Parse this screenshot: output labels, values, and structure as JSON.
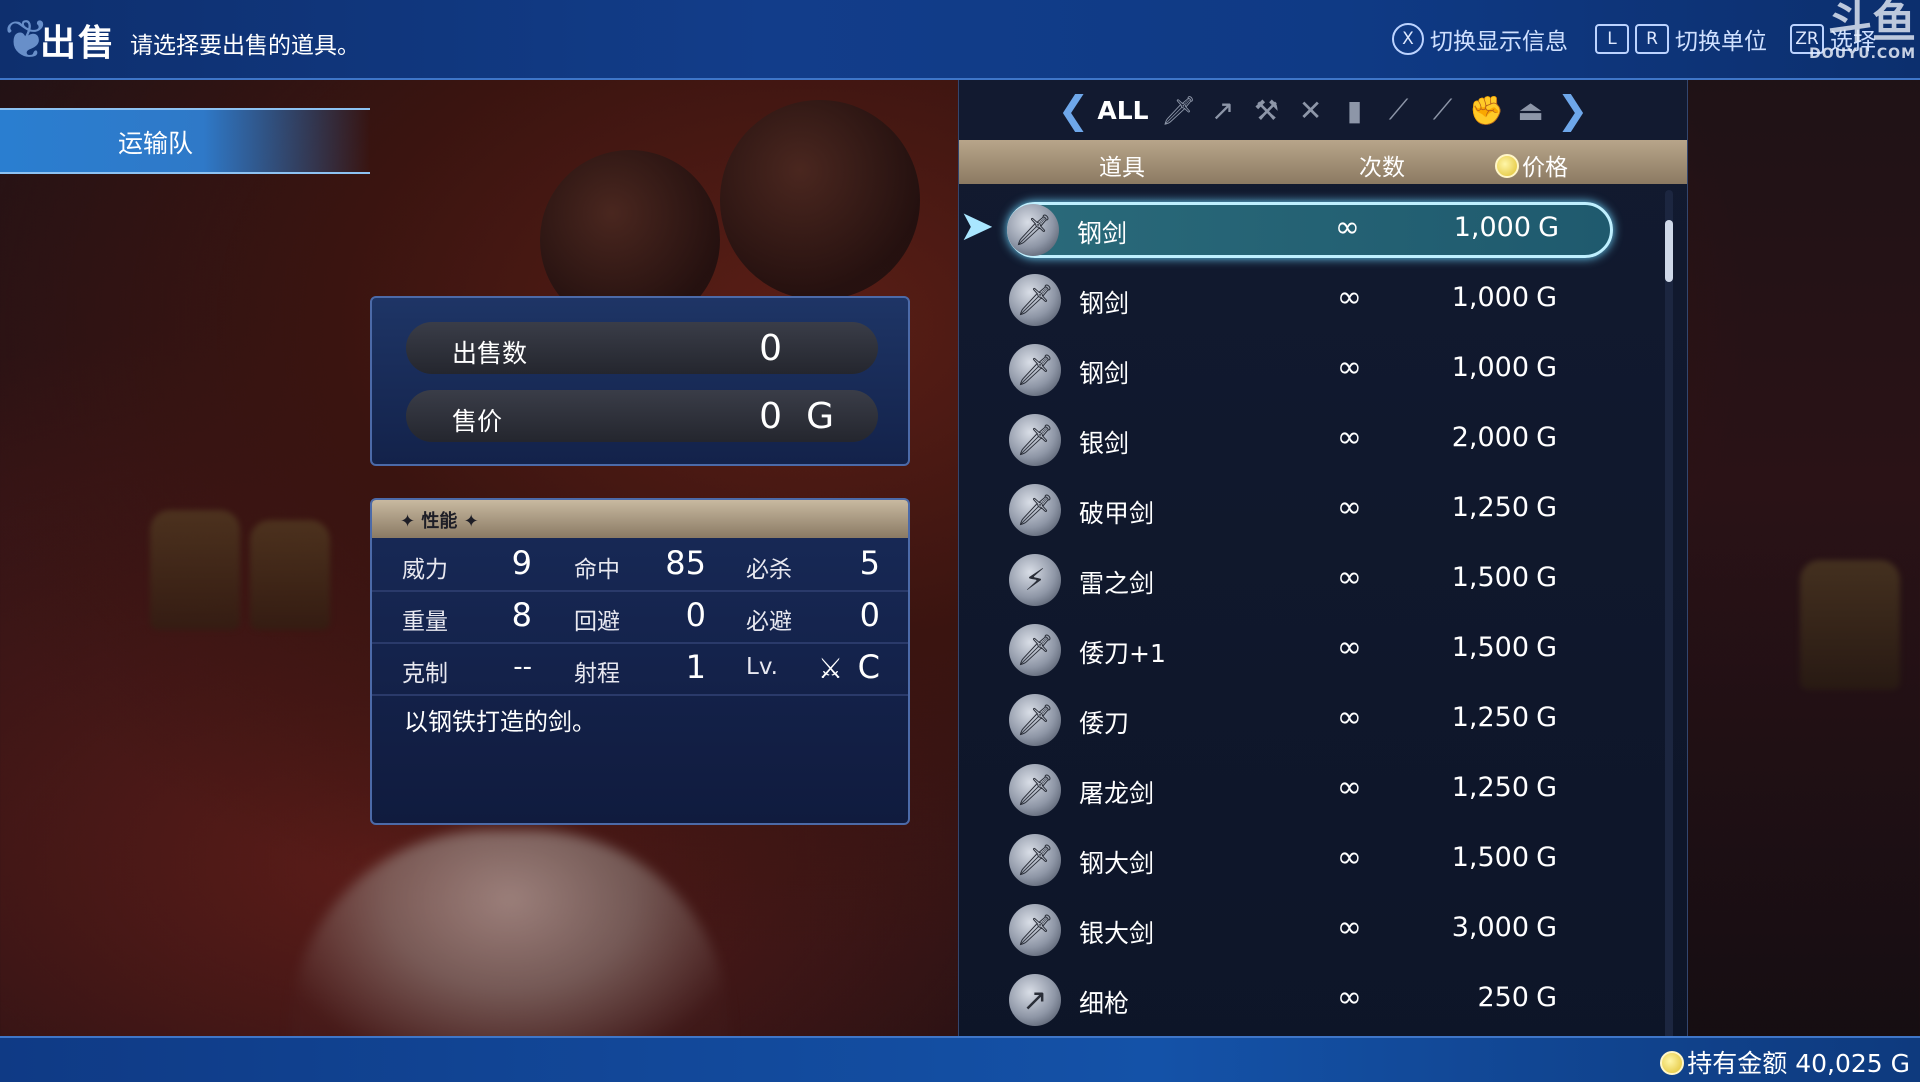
{
  "header": {
    "title": "出售",
    "hint": "请选择要出售的道具。",
    "buttons": [
      {
        "key": "X",
        "label": "切换显示信息"
      },
      {
        "key_l": "L",
        "key_r": "R",
        "label": "切换单位"
      },
      {
        "key": "ZR",
        "label": "选择"
      }
    ]
  },
  "watermark": {
    "big": "斗鱼",
    "small": "DOUYU.COM"
  },
  "convoy_tab": {
    "label": "运输队"
  },
  "sell": {
    "count_label": "出售数",
    "count_value": "0",
    "price_label": "售价",
    "price_value": "0",
    "price_unit": "G"
  },
  "stats": {
    "header": "✦ 性能 ✦",
    "rows": [
      [
        {
          "label": "威力",
          "value": "9"
        },
        {
          "label": "命中",
          "value": "85"
        },
        {
          "label": "必杀",
          "value": "5"
        }
      ],
      [
        {
          "label": "重量",
          "value": "8"
        },
        {
          "label": "回避",
          "value": "0"
        },
        {
          "label": "必避",
          "value": "0"
        }
      ],
      [
        {
          "label": "克制",
          "value": "--"
        },
        {
          "label": "射程",
          "value": "1"
        },
        {
          "label": "Lv.",
          "value": "C"
        }
      ]
    ],
    "description": "以钢铁打造的剑。"
  },
  "categories": {
    "all_label": "ALL",
    "icons": [
      "sword-icon",
      "lance-icon",
      "axe-icon",
      "bow-icon",
      "tome-icon",
      "staff-icon",
      "knife-icon",
      "gauntlet-icon",
      "item-icon"
    ]
  },
  "columns": {
    "item": "道具",
    "uses": "次数",
    "price": "价格"
  },
  "items": [
    {
      "name": "钢剑",
      "uses": "∞",
      "price": "1,000",
      "unit": "G"
    },
    {
      "name": "钢剑",
      "uses": "∞",
      "price": "1,000",
      "unit": "G"
    },
    {
      "name": "钢剑",
      "uses": "∞",
      "price": "1,000",
      "unit": "G"
    },
    {
      "name": "银剑",
      "uses": "∞",
      "price": "2,000",
      "unit": "G"
    },
    {
      "name": "破甲剑",
      "uses": "∞",
      "price": "1,250",
      "unit": "G"
    },
    {
      "name": "雷之剑",
      "uses": "∞",
      "price": "1,500",
      "unit": "G"
    },
    {
      "name": "倭刀+1",
      "uses": "∞",
      "price": "1,500",
      "unit": "G"
    },
    {
      "name": "倭刀",
      "uses": "∞",
      "price": "1,250",
      "unit": "G"
    },
    {
      "name": "屠龙剑",
      "uses": "∞",
      "price": "1,250",
      "unit": "G"
    },
    {
      "name": "钢大剑",
      "uses": "∞",
      "price": "1,500",
      "unit": "G"
    },
    {
      "name": "银大剑",
      "uses": "∞",
      "price": "3,000",
      "unit": "G"
    },
    {
      "name": "细枪",
      "uses": "∞",
      "price": "250",
      "unit": "G"
    }
  ],
  "footer": {
    "gold_text": "持有金额 40,025 G"
  }
}
